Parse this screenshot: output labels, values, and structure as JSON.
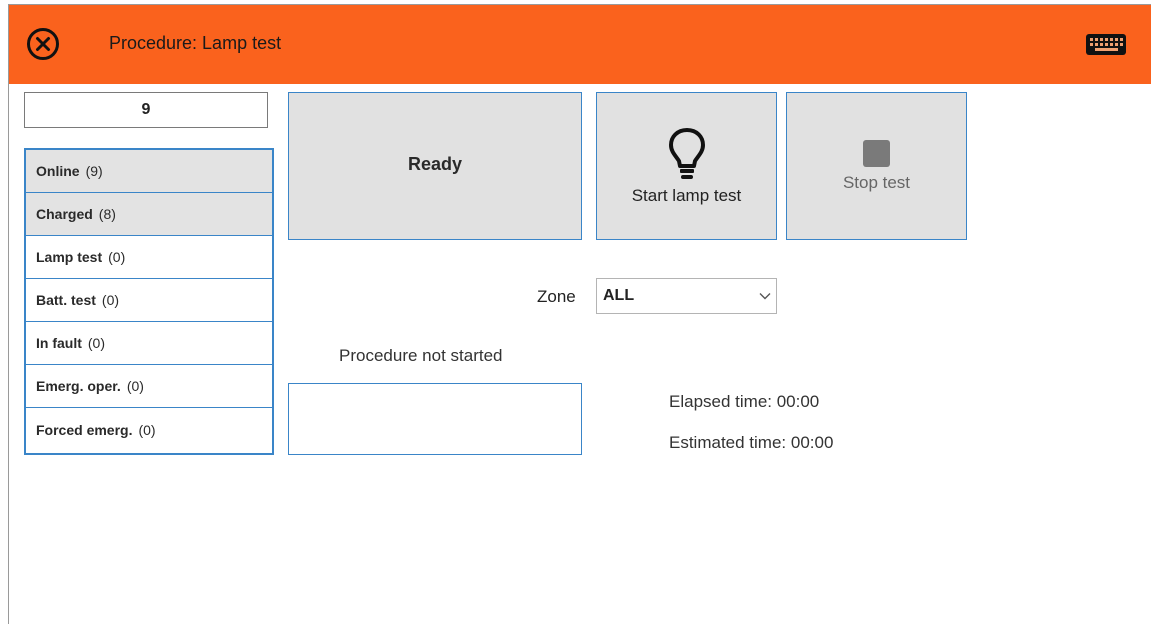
{
  "header": {
    "title": "Procedure: Lamp test",
    "close_icon": "close-circle-icon",
    "keyboard_icon": "keyboard-icon",
    "bar_color": "#fa621d"
  },
  "counter": {
    "value": "9"
  },
  "status_list": {
    "items": [
      {
        "label": "Online",
        "count": "(9)",
        "active": true
      },
      {
        "label": "Charged",
        "count": "(8)",
        "active": true
      },
      {
        "label": "Lamp test",
        "count": "(0)",
        "active": false
      },
      {
        "label": "Batt. test",
        "count": "(0)",
        "active": false
      },
      {
        "label": "In fault",
        "count": "(0)",
        "active": false
      },
      {
        "label": "Emerg. oper.",
        "count": "(0)",
        "active": false
      },
      {
        "label": "Forced emerg.",
        "count": "(0)",
        "active": false
      }
    ]
  },
  "buttons": {
    "ready_label": "Ready",
    "start_label": "Start lamp test",
    "start_icon": "lightbulb-icon",
    "stop_label": "Stop test",
    "stop_icon": "stop-square-icon"
  },
  "zone": {
    "label": "Zone",
    "selected": "ALL"
  },
  "procedure": {
    "status": "Procedure not started",
    "elapsed": "Elapsed time: 00:00",
    "estimated": "Estimated time: 00:00"
  },
  "colors": {
    "accent_border": "#3a85c8",
    "button_bg": "#e1e1e1"
  }
}
